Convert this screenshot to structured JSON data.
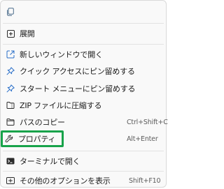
{
  "context_menu": {
    "top_icons": [
      {
        "name": "copy-icon"
      }
    ],
    "items": [
      {
        "label": "展開",
        "shortcut": "",
        "icon": "expand-icon"
      },
      {
        "label": "新しいウィンドウで開く",
        "shortcut": "",
        "icon": "open-new-window-icon"
      },
      {
        "label": "クイック アクセスにピン留めする",
        "shortcut": "",
        "icon": "pin-icon"
      },
      {
        "label": "スタート メニューにピン留めする",
        "shortcut": "",
        "icon": "pin-icon"
      },
      {
        "label": "ZIP ファイルに圧縮する",
        "shortcut": "",
        "icon": "zip-icon"
      },
      {
        "label": "パスのコピー",
        "shortcut": "Ctrl+Shift+C",
        "icon": "copy-path-icon"
      },
      {
        "label": "プロパティ",
        "shortcut": "Alt+Enter",
        "icon": "wrench-icon"
      },
      {
        "label": "ターミナルで開く",
        "shortcut": "",
        "icon": "terminal-icon"
      },
      {
        "label": "その他のオプションを表示",
        "shortcut": "Shift+F10",
        "icon": "more-options-icon"
      }
    ],
    "highlight_color": "#18a34a"
  }
}
